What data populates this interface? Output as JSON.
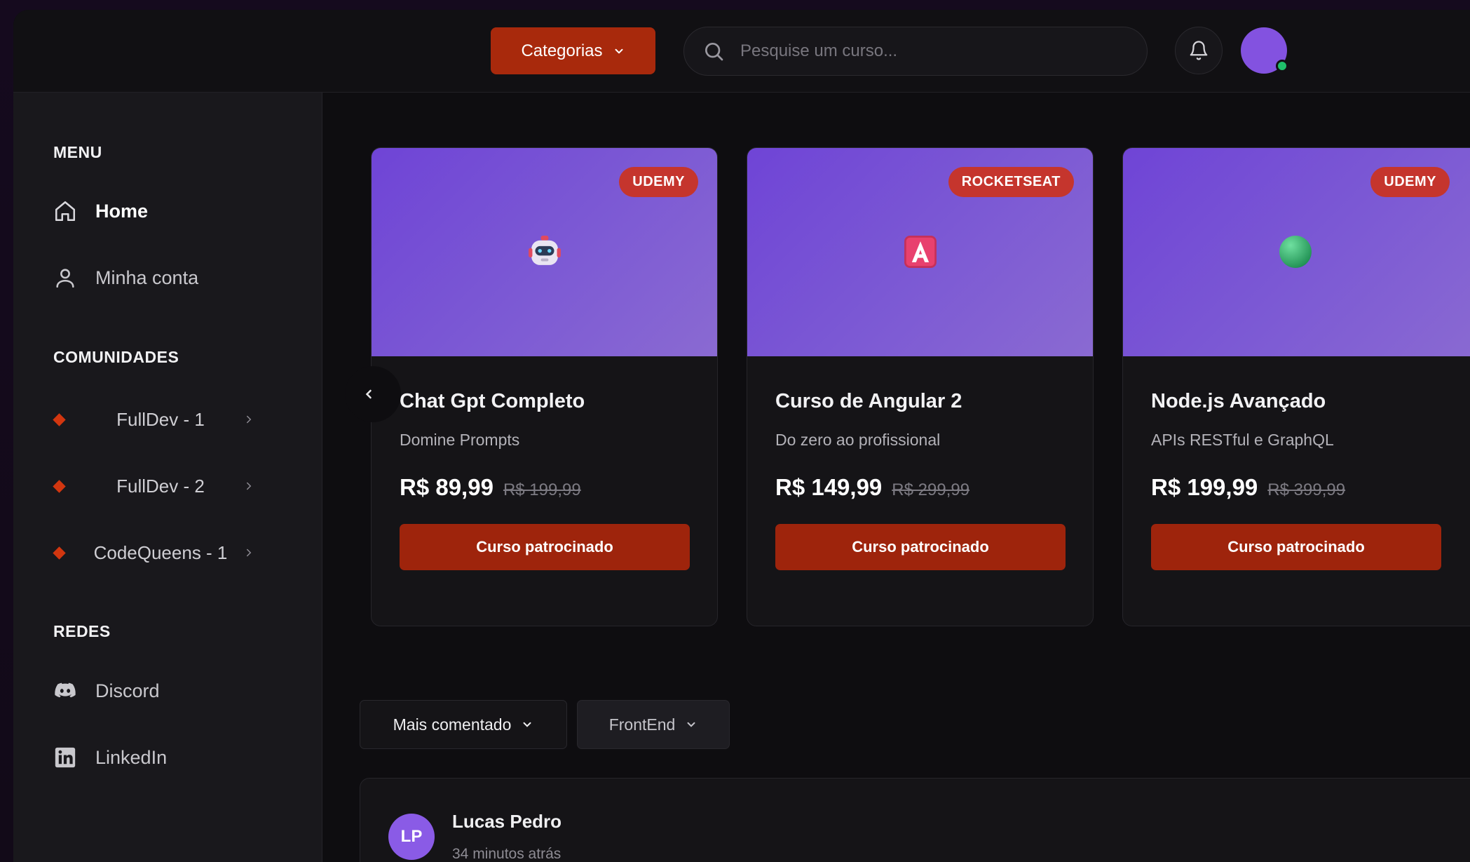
{
  "header": {
    "categories_label": "Categorias",
    "search_placeholder": "Pesquise um curso...",
    "notification_icon": "bell-icon",
    "avatar_status_color": "#1fbf6a"
  },
  "sidebar": {
    "menu_title": "MENU",
    "menu_items": [
      {
        "label": "Home",
        "icon": "home-icon",
        "active": true
      },
      {
        "label": "Minha conta",
        "icon": "user-icon",
        "active": false
      }
    ],
    "communities_title": "COMUNIDADES",
    "communities": [
      {
        "label": "FullDev - 1"
      },
      {
        "label": "FullDev - 2"
      },
      {
        "label": "CodeQueens - 1"
      }
    ],
    "networks_title": "REDES",
    "networks": [
      {
        "label": "Discord",
        "icon": "discord-icon"
      },
      {
        "label": "LinkedIn",
        "icon": "linkedin-icon"
      }
    ]
  },
  "courses": [
    {
      "badge": "UDEMY",
      "emoji": "robot-icon",
      "title": "Chat Gpt Completo",
      "subtitle": "Domine Prompts",
      "price": "R$ 89,99",
      "old_price": "R$ 199,99",
      "cta": "Curso patrocinado"
    },
    {
      "badge": "ROCKETSEAT",
      "emoji": "angular-logo-icon",
      "title": "Curso de Angular 2",
      "subtitle": "Do zero ao profissional",
      "price": "R$ 149,99",
      "old_price": "R$ 299,99",
      "cta": "Curso patrocinado"
    },
    {
      "badge": "UDEMY",
      "emoji": "green-circle-icon",
      "title": "Node.js Avançado",
      "subtitle": "APIs RESTful e GraphQL",
      "price": "R$ 199,99",
      "old_price": "R$ 399,99",
      "cta": "Curso patrocinado"
    }
  ],
  "filters": {
    "sort_label": "Mais comentado",
    "topic_label": "FrontEnd"
  },
  "post": {
    "initials": "LP",
    "author": "Lucas Pedro",
    "time": "34 minutos atrás"
  },
  "colors": {
    "accent": "#a8290c",
    "badge": "#c5352d",
    "banner": "#7b58d4",
    "avatar": "#8352e0"
  }
}
